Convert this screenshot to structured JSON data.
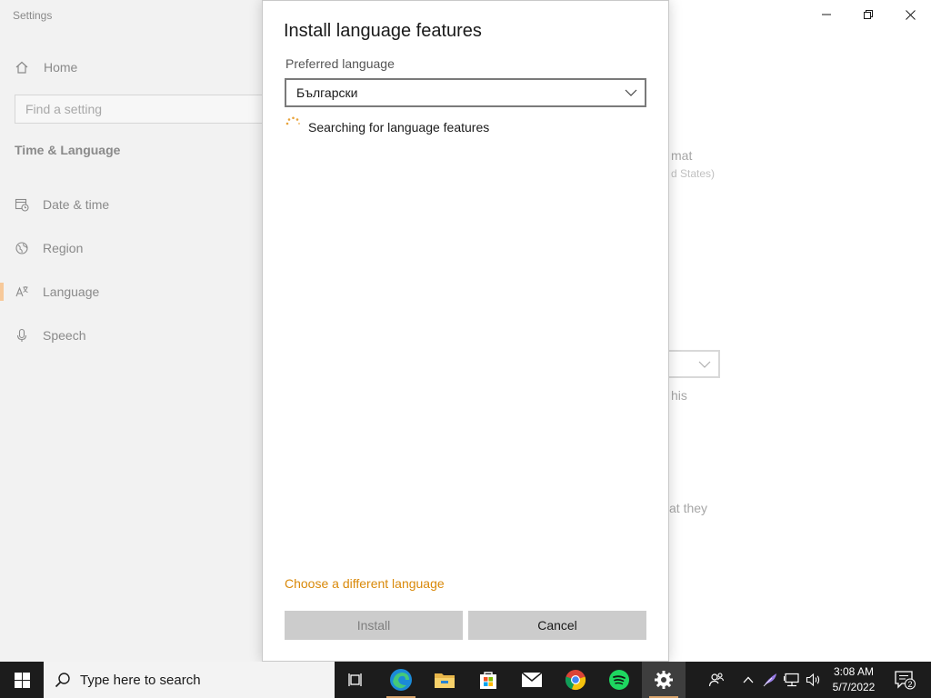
{
  "settings": {
    "app_title": "Settings",
    "home_label": "Home",
    "search_placeholder": "Find a setting",
    "section_title": "Time & Language",
    "nav_items": [
      {
        "label": "Date & time",
        "icon": "calendar-clock-icon"
      },
      {
        "label": "Region",
        "icon": "globe-icon"
      },
      {
        "label": "Language",
        "icon": "language-icon",
        "active": true
      },
      {
        "label": "Speech",
        "icon": "microphone-icon"
      }
    ],
    "background_text": {
      "format_fragment": "mat",
      "region_fragment": "d States)",
      "this_fragment": "his",
      "they_fragment": "at they"
    }
  },
  "dialog": {
    "title": "Install language features",
    "preferred_label": "Preferred language",
    "selected_language": "Български",
    "status_text": "Searching for language features",
    "link_text": "Choose a different language",
    "install_label": "Install",
    "cancel_label": "Cancel"
  },
  "taskbar": {
    "search_placeholder": "Type here to search",
    "time": "3:08 AM",
    "date": "5/7/2022",
    "notification_count": "2",
    "pinned": [
      "task-view-icon",
      "edge-icon",
      "file-explorer-icon",
      "store-icon",
      "mail-icon",
      "chrome-icon",
      "spotify-icon",
      "settings-gear-icon"
    ]
  },
  "colors": {
    "accent": "#d9890a",
    "sidebar_bg": "#f2f2f2",
    "taskbar_bg": "#1c1c1c",
    "button_bg": "#cccccc"
  }
}
